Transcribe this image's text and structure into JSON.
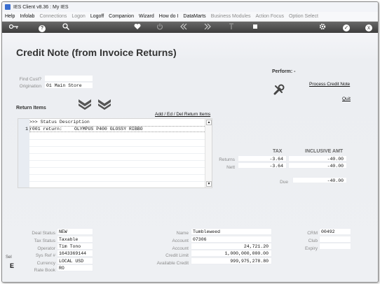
{
  "window": {
    "title": "IES Client v8.36 : My IES"
  },
  "menu": [
    {
      "label": "Help",
      "enabled": true
    },
    {
      "label": "Infolab",
      "enabled": true
    },
    {
      "label": "Connections",
      "enabled": false
    },
    {
      "label": "Logon",
      "enabled": false
    },
    {
      "label": "Logoff",
      "enabled": true
    },
    {
      "label": "Companion",
      "enabled": true
    },
    {
      "label": "Wizard",
      "enabled": true
    },
    {
      "label": "How do I",
      "enabled": true
    },
    {
      "label": "DataMarts",
      "enabled": true
    },
    {
      "label": "Business Modules",
      "enabled": false
    },
    {
      "label": "Action Focus",
      "enabled": false
    },
    {
      "label": "Option Select",
      "enabled": false
    }
  ],
  "toolbar": {
    "icons": [
      "key-icon",
      "help-icon",
      "search-icon",
      "heart-icon",
      "power-icon",
      "rewind-icon",
      "fast-forward-icon",
      "upload-icon",
      "stop-icon",
      "settings-icon",
      "check-icon",
      "close-icon"
    ],
    "help_glyph": "?",
    "close_glyph": "x",
    "check_glyph": "✓"
  },
  "page": {
    "title": "Credit Note (from Invoice Returns)",
    "find_cust_label": "Find Cust?",
    "origination_label": "Origination",
    "origination_value": "01 Main Store"
  },
  "perform": {
    "label": "Perform: -",
    "process_label": "Process Credit Note",
    "quit_label": "Quit"
  },
  "return_items": {
    "label": "Return Items",
    "add_edit_label": "Add / Ed / Del Return Items",
    "header": ">>> Status    Description",
    "rows": [
      {
        "num": "1",
        "status": "r001 return:",
        "description": "OLYMPUS P400 GLOSSY RIBBO"
      }
    ]
  },
  "totals": {
    "tax_header": "TAX",
    "incl_header": "INCLUSIVE AMT",
    "returns_label": "Returns",
    "returns_tax": "-3.64",
    "returns_incl": "-40.00",
    "nett_label": "Nett",
    "nett_tax": "-3.64",
    "nett_incl": "-40.00",
    "due_label": "Due",
    "due_amount": "-40.00"
  },
  "deal": {
    "deal_status_label": "Deal Status",
    "deal_status": "NEW",
    "tax_status_label": "Tax Status",
    "tax_status": "Taxable",
    "operator_label": "Operator",
    "operator": "Tim Tono",
    "sys_ref_label": "Sys Ref #",
    "sys_ref": "1643369144",
    "currency_label": "Currency",
    "currency": "LOCAL USD",
    "rate_book_label": "Rate Book",
    "rate_book": "RO"
  },
  "account": {
    "name_label": "Name",
    "name": "Tumbleweed",
    "account_label": "Account",
    "account": "07306",
    "balance_label": "Account",
    "balance": "24,721.20",
    "credit_limit_label": "Credit Limit",
    "credit_limit": "1,000,000,000.00",
    "available_label": "Available Credit",
    "available": "999,975,278.80"
  },
  "crm": {
    "crm_label": "CRM",
    "crm": "00492",
    "club_label": "Club",
    "expiry_label": "Expiry"
  },
  "left_edge": {
    "top": "Sel",
    "bottom": "E"
  }
}
